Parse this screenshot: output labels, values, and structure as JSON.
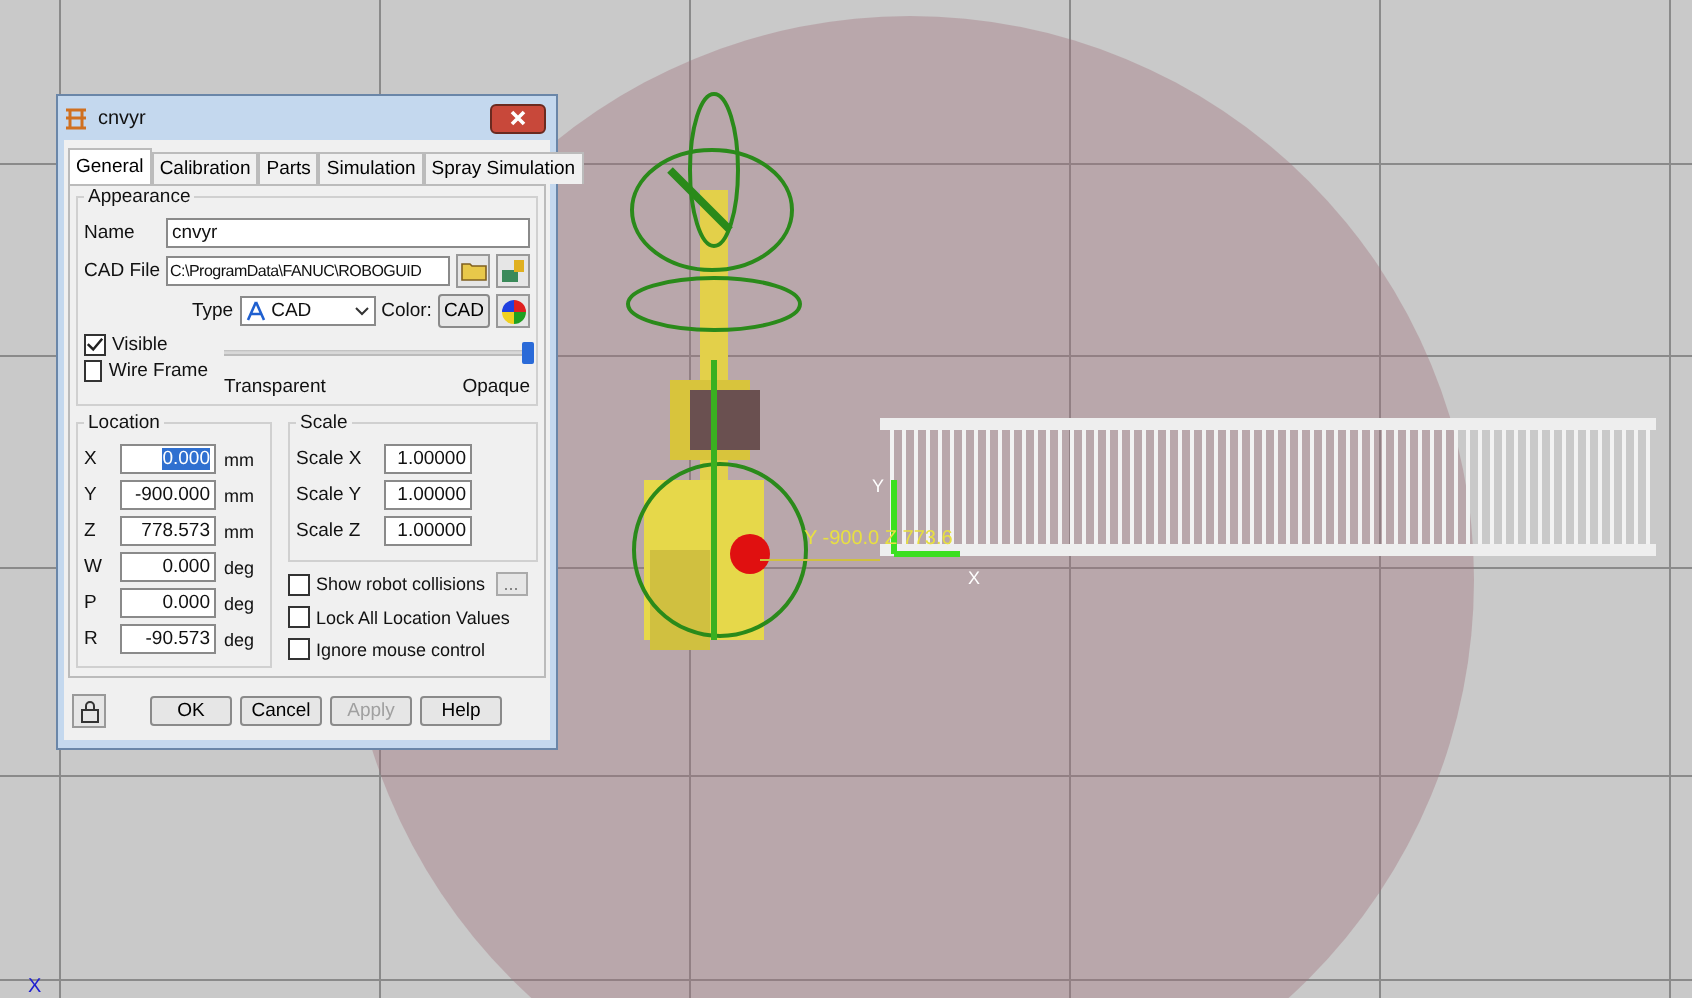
{
  "viewport": {
    "readout": "Y -900.0 Z 773.6",
    "axis_labels": [
      "Y",
      "X"
    ],
    "corner_label": "X"
  },
  "dialog": {
    "title": "cnvyr",
    "tabs": [
      {
        "label": "General",
        "selected": true
      },
      {
        "label": "Calibration",
        "selected": false
      },
      {
        "label": "Parts",
        "selected": false
      },
      {
        "label": "Simulation",
        "selected": false
      },
      {
        "label": "Spray Simulation",
        "selected": false
      }
    ],
    "appearance": {
      "title": "Appearance",
      "name_label": "Name",
      "name_value": "cnvyr",
      "cad_label": "CAD File",
      "cad_value": "C:\\ProgramData\\FANUC\\ROBOGUID",
      "type_label": "Type",
      "type_value": "CAD",
      "color_label": "Color:",
      "color_button": "CAD",
      "checks": [
        {
          "label": "Visible",
          "checked": true
        },
        {
          "label": "Wire Frame",
          "checked": false
        }
      ],
      "opacity": {
        "level": 1.0,
        "min_label": "Transparent",
        "max_label": "Opaque"
      }
    },
    "location": {
      "title": "Location",
      "rows": [
        {
          "axis": "X",
          "value": "0.000",
          "unit": "mm",
          "selected": true
        },
        {
          "axis": "Y",
          "value": "-900.000",
          "unit": "mm",
          "selected": false
        },
        {
          "axis": "Z",
          "value": "778.573",
          "unit": "mm",
          "selected": false
        },
        {
          "axis": "W",
          "value": "0.000",
          "unit": "deg",
          "selected": false
        },
        {
          "axis": "P",
          "value": "0.000",
          "unit": "deg",
          "selected": false
        },
        {
          "axis": "R",
          "value": "-90.573",
          "unit": "deg",
          "selected": false
        }
      ]
    },
    "scale": {
      "title": "Scale",
      "rows": [
        {
          "label": "Scale X",
          "value": "1.00000"
        },
        {
          "label": "Scale Y",
          "value": "1.00000"
        },
        {
          "label": "Scale Z",
          "value": "1.00000"
        }
      ]
    },
    "options": [
      {
        "label": "Show robot collisions",
        "checked": false,
        "more": "..."
      },
      {
        "label": "Lock All Location Values",
        "checked": false
      },
      {
        "label": "Ignore mouse control",
        "checked": false
      }
    ],
    "buttons": [
      {
        "label": "OK",
        "disabled": false
      },
      {
        "label": "Cancel",
        "disabled": false
      },
      {
        "label": "Apply",
        "disabled": true
      },
      {
        "label": "Help",
        "disabled": false
      }
    ]
  }
}
